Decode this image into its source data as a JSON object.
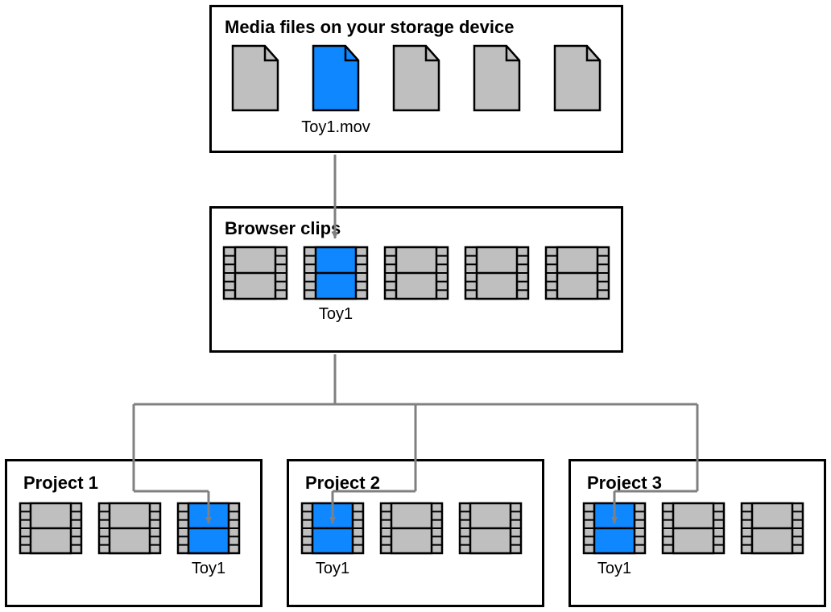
{
  "colors": {
    "highlight": "#0F87FF",
    "grey": "#BFBFBF",
    "arrow": "#808080"
  },
  "storage": {
    "title": "Media files on your storage device",
    "file_label": "Toy1.mov"
  },
  "browser": {
    "title": "Browser clips",
    "clip_label": "Toy1"
  },
  "projects": [
    {
      "title": "Project 1",
      "clip_label": "Toy1",
      "highlight_index": 2
    },
    {
      "title": "Project 2",
      "clip_label": "Toy1",
      "highlight_index": 0
    },
    {
      "title": "Project 3",
      "clip_label": "Toy1",
      "highlight_index": 0
    }
  ]
}
